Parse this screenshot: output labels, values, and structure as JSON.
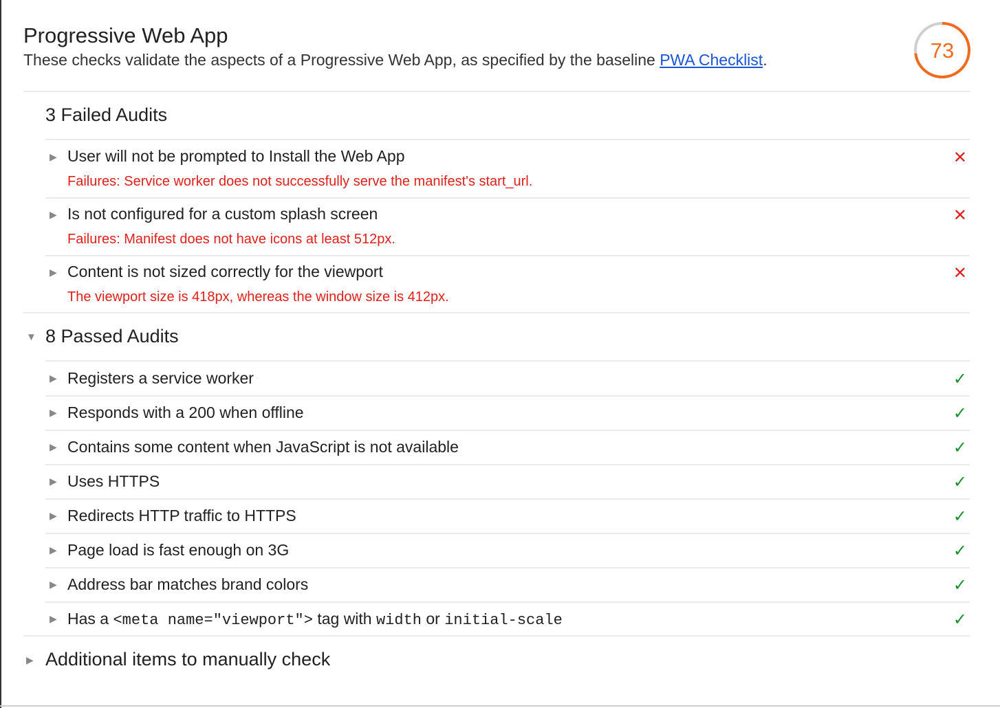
{
  "header": {
    "title": "Progressive Web App",
    "description": "These checks validate the aspects of a Progressive Web App, as specified by the baseline ",
    "link": "PWA Checklist",
    "period": ".",
    "score": "73",
    "score_value": 73,
    "score_color": "#ef6b1f"
  },
  "failed": {
    "heading": "3 Failed Audits",
    "items": [
      {
        "title": "User will not be prompted to Install the Web App",
        "detail": "Failures: Service worker does not successfully serve the manifest's start_url."
      },
      {
        "title": "Is not configured for a custom splash screen",
        "detail": "Failures: Manifest does not have icons at least 512px."
      },
      {
        "title": "Content is not sized correctly for the viewport",
        "detail": "The viewport size is 418px, whereas the window size is 412px."
      }
    ]
  },
  "passed": {
    "heading": "8 Passed Audits",
    "items": [
      {
        "title": "Registers a service worker"
      },
      {
        "title": "Responds with a 200 when offline"
      },
      {
        "title": "Contains some content when JavaScript is not available"
      },
      {
        "title": "Uses HTTPS"
      },
      {
        "title": "Redirects HTTP traffic to HTTPS"
      },
      {
        "title": "Page load is fast enough on 3G"
      },
      {
        "title": "Address bar matches brand colors"
      },
      {
        "title_parts": [
          "Has a ",
          "<meta  name=\"viewport\">",
          " tag with ",
          "width",
          " or ",
          "initial-scale"
        ]
      }
    ]
  },
  "manual": {
    "heading": "Additional items to manually check"
  },
  "icons": {
    "fail": "✕",
    "pass": "✓",
    "collapsed": "▶",
    "expanded": "▼"
  }
}
